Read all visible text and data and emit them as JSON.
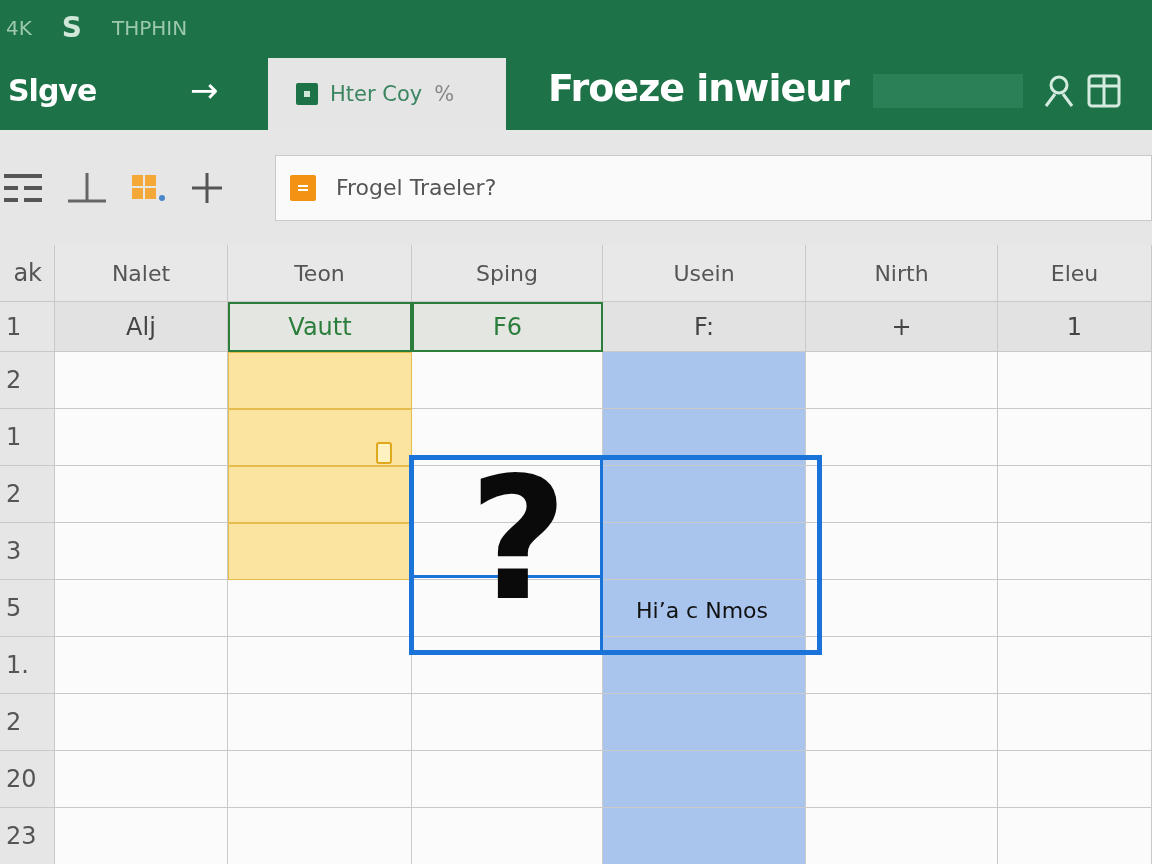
{
  "title_bar": {
    "items": [
      "4K",
      "S",
      "THPHIN"
    ]
  },
  "ribbon": {
    "brand": "Slgve",
    "arrow": "→",
    "tabs": [
      {
        "label": "Hter Coy",
        "suffix": "%",
        "selected": true
      }
    ],
    "title": "Froeze inwieur"
  },
  "formula_bar": {
    "value": "Frogel Traeler?"
  },
  "grid": {
    "corner": "ak",
    "columns": [
      {
        "label": "Nalet"
      },
      {
        "label": "Teon",
        "color": "#fbe3a0"
      },
      {
        "label": "Sping"
      },
      {
        "label": "Usein",
        "color": "#a9c5ee"
      },
      {
        "label": "Nirth"
      },
      {
        "label": "Eleu"
      }
    ],
    "header_row": {
      "number": "1",
      "cells": [
        {
          "text": "Alj",
          "selected": false
        },
        {
          "text": "Vautt",
          "selected": true
        },
        {
          "text": "F6",
          "selected": true
        },
        {
          "text": "F:",
          "selected": false
        },
        {
          "text": "+",
          "selected": false
        },
        {
          "text": "1",
          "selected": false
        }
      ]
    },
    "rows": [
      {
        "number": "2",
        "highlighted": [
          false,
          true,
          false,
          true,
          false,
          false
        ]
      },
      {
        "number": "1",
        "highlighted": [
          false,
          true,
          false,
          true,
          false,
          false
        ]
      },
      {
        "number": "2",
        "highlighted": [
          false,
          true,
          false,
          true,
          false,
          false
        ]
      },
      {
        "number": "3",
        "highlighted": [
          false,
          true,
          false,
          true,
          false,
          false
        ]
      },
      {
        "number": "5",
        "highlighted": [
          false,
          false,
          false,
          true,
          false,
          false
        ]
      },
      {
        "number": "1.",
        "highlighted": [
          false,
          false,
          false,
          true,
          false,
          false
        ]
      },
      {
        "number": "2",
        "highlighted": [
          false,
          false,
          false,
          true,
          false,
          false
        ]
      },
      {
        "number": "20",
        "highlighted": [
          false,
          false,
          false,
          true,
          false,
          false
        ]
      },
      {
        "number": "23",
        "highlighted": [
          false,
          false,
          false,
          true,
          false,
          false
        ]
      }
    ],
    "callout": {
      "symbol": "?",
      "label": "Hi’a c Nmos"
    }
  }
}
